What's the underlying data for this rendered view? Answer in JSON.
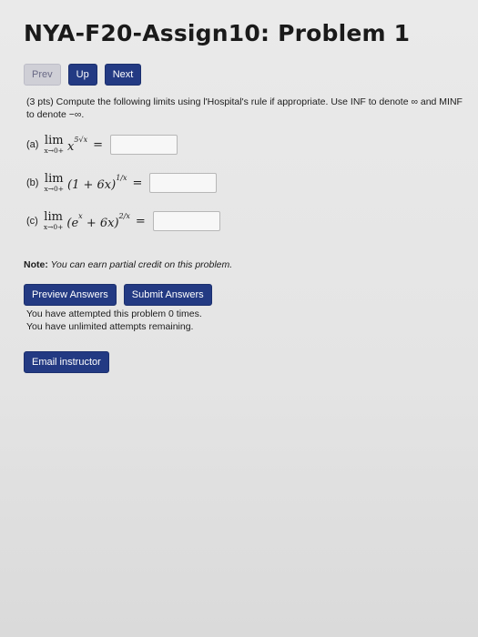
{
  "header": {
    "title": "NYA-F20-Assign10: Problem 1"
  },
  "nav": {
    "prev": "Prev",
    "up": "Up",
    "next": "Next"
  },
  "problem": {
    "prompt": "(3 pts) Compute the following limits using l'Hospital's rule if appropriate. Use INF to denote ∞ and MINF to denote −∞.",
    "parts": [
      {
        "label": "(a)",
        "limit": "lim",
        "subscript": "x→0+",
        "expression": "x",
        "exponent": "5√x",
        "equals": "=",
        "answer": ""
      },
      {
        "label": "(b)",
        "limit": "lim",
        "subscript": "x→0+",
        "expression": "(1 + 6x)",
        "exponent": "1/x",
        "equals": "=",
        "answer": ""
      },
      {
        "label": "(c)",
        "limit": "lim",
        "subscript": "x→0+",
        "expression": "(e",
        "exp_inner": "x",
        "expression2": " + 6x)",
        "exponent": "2/x",
        "equals": "=",
        "answer": ""
      }
    ]
  },
  "note": {
    "prefix": "Note:",
    "text": " You can earn partial credit on this problem."
  },
  "actions": {
    "preview": "Preview Answers",
    "submit": "Submit Answers"
  },
  "status": {
    "attempts": "You have attempted this problem 0 times.",
    "remaining": "You have unlimited attempts remaining."
  },
  "email": {
    "label": "Email instructor"
  }
}
